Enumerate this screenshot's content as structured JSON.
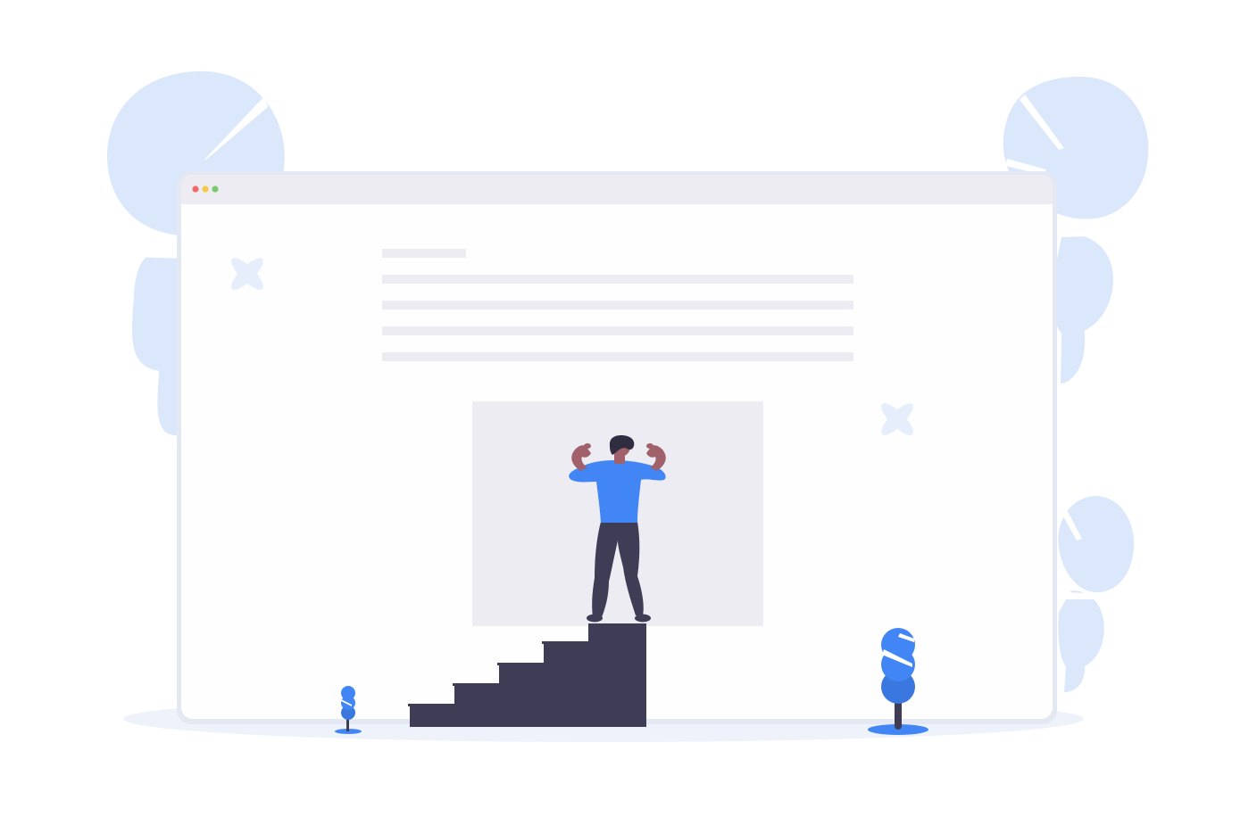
{
  "colors": {
    "background": "#ffffff",
    "foliage": "#dbe7fa",
    "ground": "#eef2fb",
    "window_frame": "#e4e8f2",
    "window_body": "#fefefe",
    "titlebar": "#ececf2",
    "text_placeholder": "#ececf2",
    "image_placeholder": "#ececf2",
    "stairs": "#3f3d56",
    "shirt": "#4285f4",
    "pants": "#3f3d56",
    "skin": "#a0616a",
    "hair": "#2f2e41",
    "plant": "#4285f4",
    "plant_dark": "#3a78e0",
    "sparkle": "#e6edfb",
    "dot_close": "#f26b6b",
    "dot_minimize": "#f5c945",
    "dot_maximize": "#7ac96b"
  },
  "illustration": {
    "subject": "person-flexing-on-top-of-stairs",
    "window_controls": [
      "close-dot",
      "minimize-dot",
      "maximize-dot"
    ],
    "icons": [
      "sparkle-icon",
      "sparkle-icon",
      "plant-icon",
      "plant-icon",
      "bush-icon",
      "bush-icon",
      "bush-icon"
    ]
  }
}
